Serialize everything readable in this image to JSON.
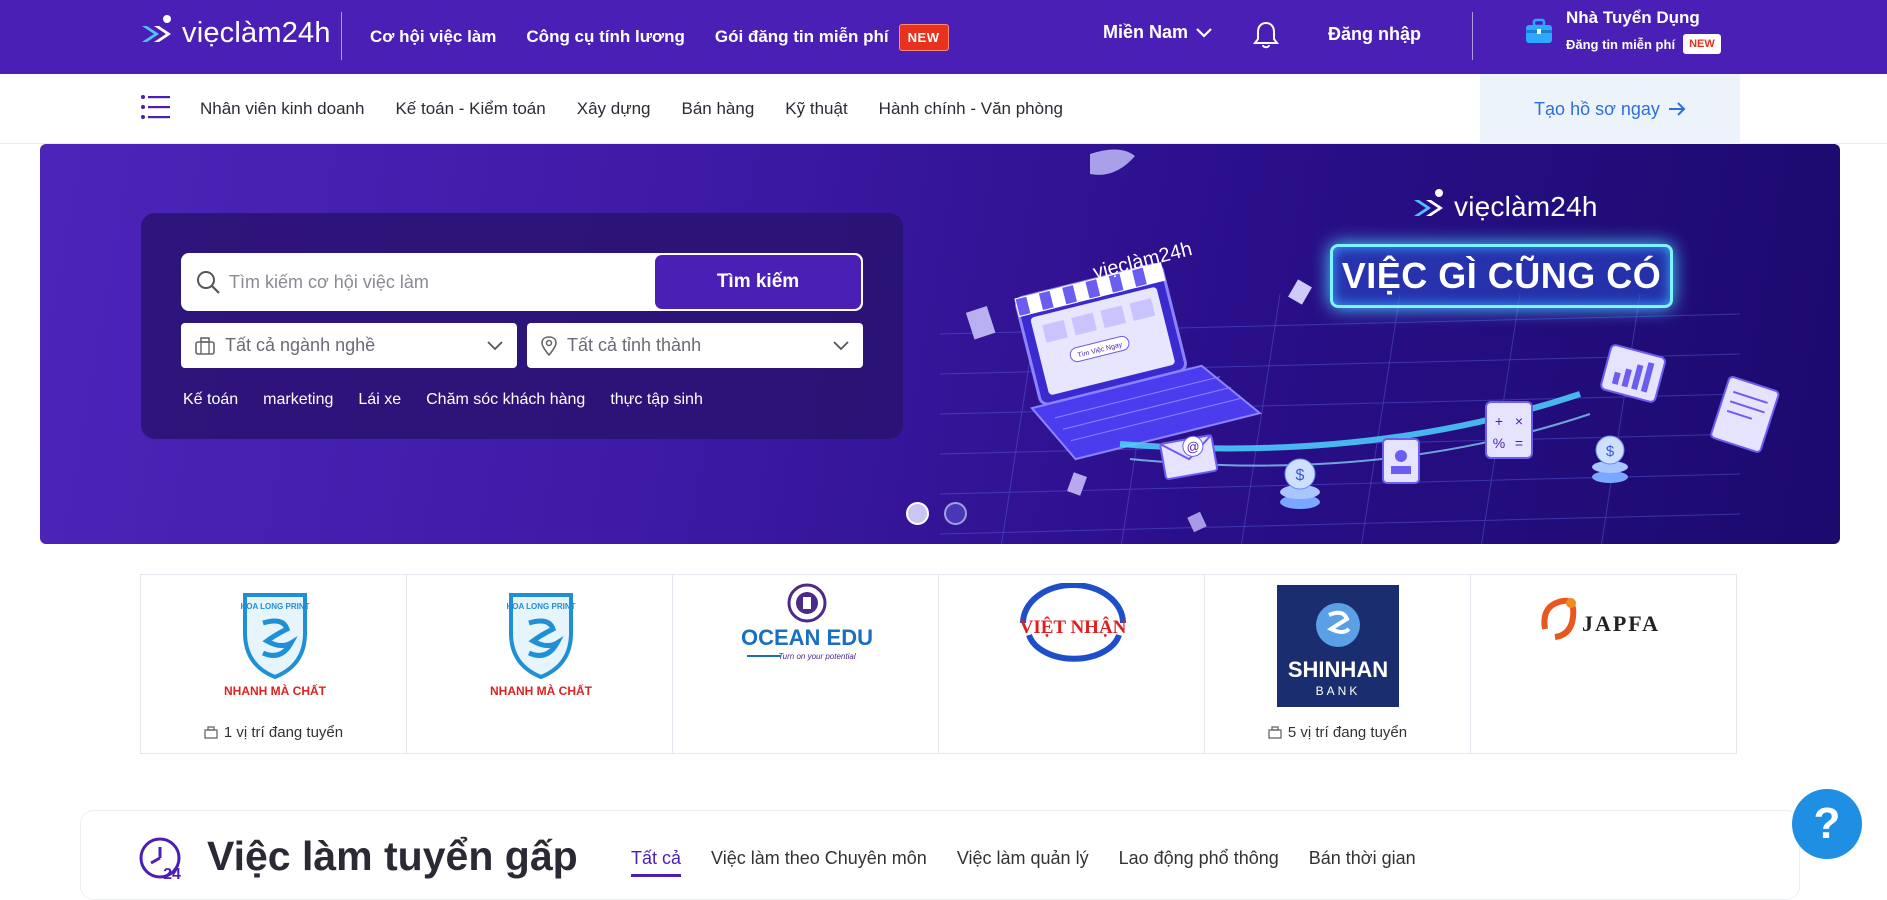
{
  "header": {
    "brand": "viẹclàm24h",
    "nav": [
      {
        "label": "Cơ hội việc làm"
      },
      {
        "label": "Công cụ tính lương"
      },
      {
        "label": "Gói đăng tin miễn phí",
        "badge": "NEW"
      }
    ],
    "region": "Miền Nam",
    "login": "Đăng nhập",
    "employer": {
      "title": "Nhà Tuyển Dụng",
      "subtitle": "Đăng tin miễn phí",
      "badge": "NEW"
    }
  },
  "categories": [
    "Nhân viên kinh doanh",
    "Kế toán - Kiểm toán",
    "Xây dựng",
    "Bán hàng",
    "Kỹ thuật",
    "Hành chính - Văn phòng"
  ],
  "cta": "Tạo hồ sơ ngay",
  "search": {
    "placeholder": "Tìm kiếm cơ hội việc làm",
    "button": "Tìm kiếm",
    "industry": "Tất cả ngành nghề",
    "location": "Tất cả tỉnh thành",
    "tags": [
      "Kế toán",
      "marketing",
      "Lái xe",
      "Chăm sóc khách hàng",
      "thực tập sinh"
    ]
  },
  "banner": {
    "brand": "viẹclàm24h",
    "slogan": "VIỆC GÌ CŨNG CÓ",
    "laptop_brand": "viẹclàm24h",
    "laptop_button": "Tìm Việc Ngay",
    "slides": 2,
    "active_slide": 1
  },
  "companies": [
    {
      "name": "HOA LONG PRINT",
      "tagline": "NHANH MÀ CHẤT",
      "count": "1 vị trí đang tuyển"
    },
    {
      "name": "HOA LONG PRINT",
      "tagline": "NHANH MÀ CHẤT",
      "count": ""
    },
    {
      "name": "OCEAN EDU",
      "tagline": "Turn on your potential",
      "count": ""
    },
    {
      "name": "VIỆT NHẬN",
      "tagline": "",
      "count": ""
    },
    {
      "name": "SHINHAN",
      "tagline": "BANK",
      "count": "5 vị trí đang tuyển"
    },
    {
      "name": "JAPFA",
      "tagline": "",
      "count": ""
    }
  ],
  "urgent": {
    "title": "Việc làm tuyển gấp",
    "icon_label": "24",
    "tabs": [
      "Tất cả",
      "Việc làm theo Chuyên môn",
      "Việc làm quản lý",
      "Lao động phổ thông",
      "Bán thời gian"
    ],
    "active_tab": 0
  },
  "help": "?",
  "colors": {
    "primary": "#4a1fb5",
    "badge": "#e8321e",
    "link": "#2e6fd8",
    "help": "#1e8fe2"
  }
}
